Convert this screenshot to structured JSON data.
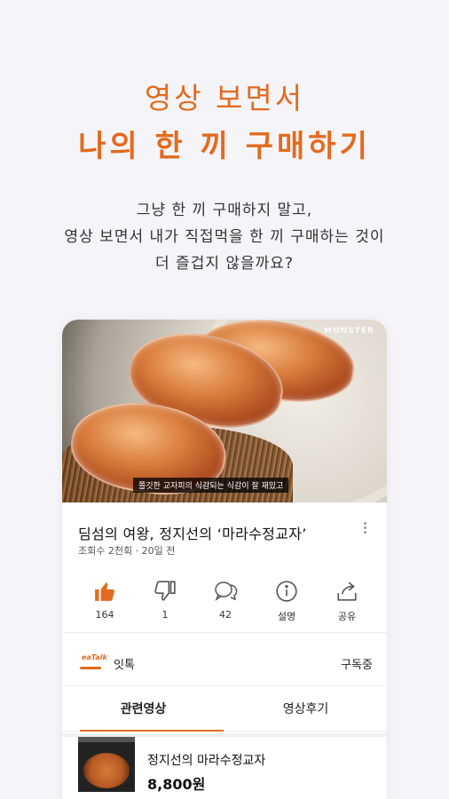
{
  "hero": {
    "line1": "영상 보면서",
    "line2": "나의 한 끼 구매하기"
  },
  "description": {
    "line1": "그냥 한 끼 구매하지 말고,",
    "line2": "영상 보면서 내가 직접먹을 한 끼 구매하는 것이",
    "line3": "더 즐겁지 않을까요?"
  },
  "video": {
    "watermark": "MONSTER",
    "subtitle": "쫄깃한 교자피의 식감되는 식감이 잘 재밌고",
    "title": "딤섬의 여왕, 정지선의 ‘마라수정교자’",
    "meta": "조회수 2천회 · 20일 전"
  },
  "actions": [
    {
      "icon": "thumbs-up-icon",
      "label": "164",
      "active": true
    },
    {
      "icon": "thumbs-down-icon",
      "label": "1",
      "active": false
    },
    {
      "icon": "comment-icon",
      "label": "42",
      "active": false
    },
    {
      "icon": "info-icon",
      "label": "설명",
      "active": false
    },
    {
      "icon": "share-icon",
      "label": "공유",
      "active": false
    }
  ],
  "channel": {
    "logo_text": "eaTalk",
    "name": "잇톡",
    "subscribe_label": "구독중"
  },
  "tabs": [
    {
      "label": "관련영상",
      "active": true
    },
    {
      "label": "영상후기",
      "active": false
    }
  ],
  "product": {
    "name": "정지선의 마라수정교자",
    "price": "8,800원"
  },
  "colors": {
    "accent": "#e46a1d",
    "background": "#f5f4f9"
  }
}
